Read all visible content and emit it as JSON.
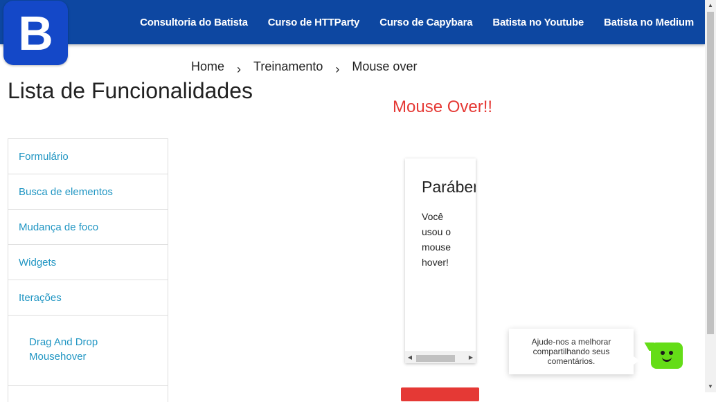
{
  "brand": {
    "logo_letter": "B",
    "primary_color": "#0d47a1",
    "logo_color": "#1448c8"
  },
  "nav": {
    "links": [
      {
        "label": "Consultoria do Batista"
      },
      {
        "label": "Curso de HTTParty"
      },
      {
        "label": "Curso de Capybara"
      },
      {
        "label": "Batista no Youtube"
      },
      {
        "label": "Batista no Medium"
      }
    ]
  },
  "breadcrumb": {
    "items": [
      {
        "label": "Home"
      },
      {
        "label": "Treinamento"
      },
      {
        "label": "Mouse over"
      }
    ],
    "separator_icon": "chevron-right-icon",
    "separator": "›"
  },
  "sidebar": {
    "title": "Lista de Funcionalidades",
    "items": [
      {
        "label": "Formulário"
      },
      {
        "label": "Busca de elementos"
      },
      {
        "label": "Mudança de foco"
      },
      {
        "label": "Widgets"
      },
      {
        "label": "Iterações"
      }
    ],
    "subitems": [
      {
        "label": "Drag And Drop"
      },
      {
        "label": "Mousehover"
      }
    ],
    "link_color": "#2196c3"
  },
  "main": {
    "title": "Mouse Over!!",
    "title_color": "#e53935",
    "card": {
      "title": "Parábens",
      "text": "Você usou o mouse hover!"
    },
    "button_color": "#e53935"
  },
  "chat": {
    "message": "Ajude-nos a melhorar compartilhando seus comentários.",
    "button_icon": "smiley-chat-icon",
    "button_color": "#64dd17"
  }
}
